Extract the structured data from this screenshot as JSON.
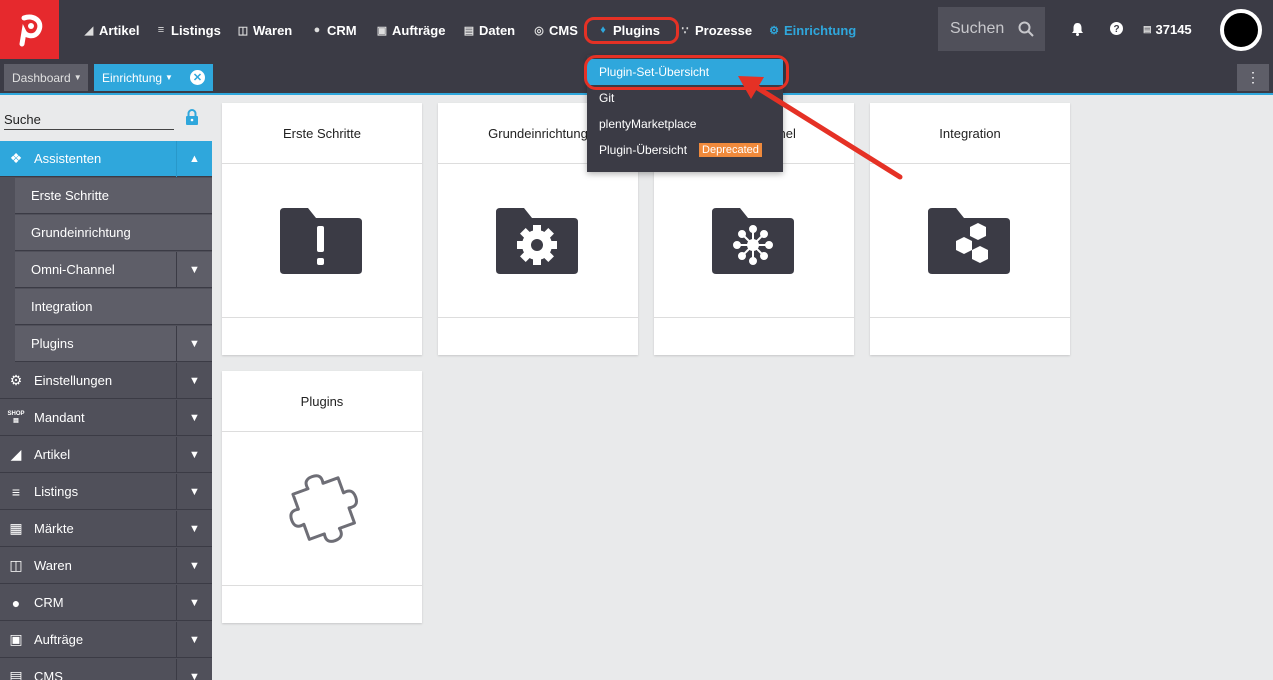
{
  "topbar": {
    "nav": [
      {
        "label": "Artikel",
        "icon": "tag-icon"
      },
      {
        "label": "Listings",
        "icon": "listings-icon"
      },
      {
        "label": "Waren",
        "icon": "boxes-icon"
      },
      {
        "label": "CRM",
        "icon": "users-icon"
      },
      {
        "label": "Aufträge",
        "icon": "cart-icon"
      },
      {
        "label": "Daten",
        "icon": "database-icon"
      },
      {
        "label": "CMS",
        "icon": "globe-icon"
      },
      {
        "label": "Plugins",
        "icon": "puzzle-icon"
      },
      {
        "label": "Prozesse",
        "icon": "flow-icon"
      },
      {
        "label": "Einrichtung",
        "icon": "gear-icon"
      }
    ],
    "active_nav": "Einrichtung",
    "search_placeholder": "Suchen",
    "user_id": "37145"
  },
  "tabs": {
    "dashboard": "Dashboard",
    "einrichtung": "Einrichtung"
  },
  "sidebar": {
    "search_label": "Suche",
    "items": [
      {
        "label": "Assistenten",
        "icon": "handshake-icon",
        "expanded": true
      },
      {
        "label": "Erste Schritte"
      },
      {
        "label": "Grundeinrichtung"
      },
      {
        "label": "Omni-Channel"
      },
      {
        "label": "Integration"
      },
      {
        "label": "Plugins"
      },
      {
        "label": "Einstellungen",
        "icon": "gear-icon"
      },
      {
        "label": "Mandant",
        "icon": "shop-icon",
        "icon_text": "SHOP"
      },
      {
        "label": "Artikel",
        "icon": "tag-icon"
      },
      {
        "label": "Listings",
        "icon": "listings-icon"
      },
      {
        "label": "Märkte",
        "icon": "markets-icon"
      },
      {
        "label": "Waren",
        "icon": "boxes-icon"
      },
      {
        "label": "CRM",
        "icon": "users-icon"
      },
      {
        "label": "Aufträge",
        "icon": "cart-icon"
      },
      {
        "label": "CMS",
        "icon": "cms-icon"
      }
    ]
  },
  "cards": [
    {
      "title": "Erste Schritte",
      "icon": "folder-exclamation-icon"
    },
    {
      "title": "Grundeinrichtung",
      "icon": "folder-gear-icon"
    },
    {
      "title": "Omni-Channel",
      "icon": "folder-network-icon"
    },
    {
      "title": "Integration",
      "icon": "folder-hexagons-icon"
    },
    {
      "title": "Plugins",
      "icon": "puzzle-outline-icon"
    }
  ],
  "dropdown": {
    "items": [
      {
        "label": "Plugin-Set-Übersicht",
        "selected": true
      },
      {
        "label": "Git"
      },
      {
        "label": "plentyMarketplace"
      },
      {
        "label": "Plugin-Übersicht",
        "badge": "Deprecated"
      }
    ]
  },
  "colors": {
    "nav_bg": "#3b3b45",
    "accent": "#2fa7dc",
    "logo": "#e6292d",
    "highlight": "#e53125",
    "badge": "#f08a3c"
  }
}
